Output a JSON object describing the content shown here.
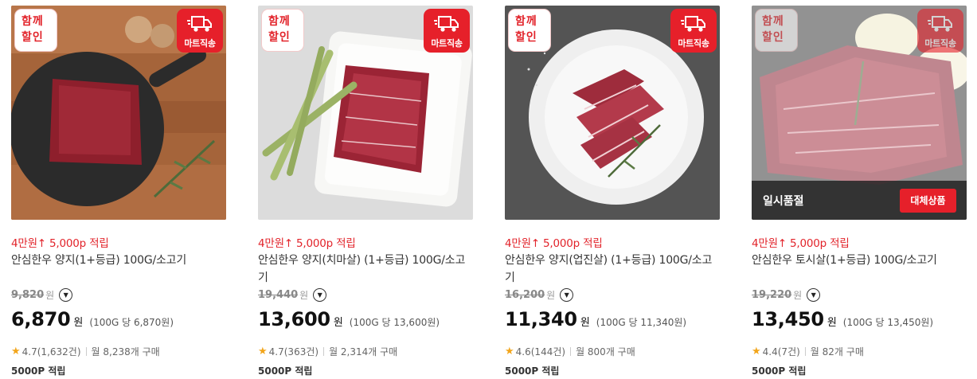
{
  "badges": {
    "together_line1": "함께",
    "together_line2": "할인",
    "mart": "마트직송"
  },
  "products": [
    {
      "promo": "4만원↑ 5,000p 적립",
      "name": "안심한우 양지(1+등급) 100G/소고기",
      "original_price": "9,820",
      "won_small": "원",
      "sale_price": "6,870",
      "won": "원",
      "unit_price": "(100G 당 6,870원)",
      "rating": "4.7",
      "reviews": "(1,632건)",
      "monthly": "월 8,238개 구매",
      "points": "5000P 적립"
    },
    {
      "promo": "4만원↑ 5,000p 적립",
      "name": "안심한우 양지(치마살) (1+등급) 100G/소고기",
      "original_price": "19,440",
      "won_small": "원",
      "sale_price": "13,600",
      "won": "원",
      "unit_price": "(100G 당 13,600원)",
      "rating": "4.7",
      "reviews": "(363건)",
      "monthly": "월 2,314개 구매",
      "points": "5000P 적립"
    },
    {
      "promo": "4만원↑ 5,000p 적립",
      "name": "안심한우 양지(업진살) (1+등급) 100G/소고기",
      "original_price": "16,200",
      "won_small": "원",
      "sale_price": "11,340",
      "won": "원",
      "unit_price": "(100G 당 11,340원)",
      "rating": "4.6",
      "reviews": "(144건)",
      "monthly": "월 800개 구매",
      "points": "5000P 적립"
    },
    {
      "promo": "4만원↑ 5,000p 적립",
      "name": "안심한우 토시살(1+등급) 100G/소고기",
      "original_price": "19,220",
      "won_small": "원",
      "sale_price": "13,450",
      "won": "원",
      "unit_price": "(100G 당 13,450원)",
      "rating": "4.4",
      "reviews": "(7건)",
      "monthly": "월 82개 구매",
      "points": "5000P 적립",
      "sold_out": "일시품절",
      "alternative_button": "대체상품"
    }
  ],
  "icons": {
    "info": "chevron-down-circle-icon",
    "star": "star-icon",
    "truck": "delivery-truck-icon"
  },
  "colors": {
    "accent_red": "#e2232a",
    "star": "#f2a51b"
  }
}
